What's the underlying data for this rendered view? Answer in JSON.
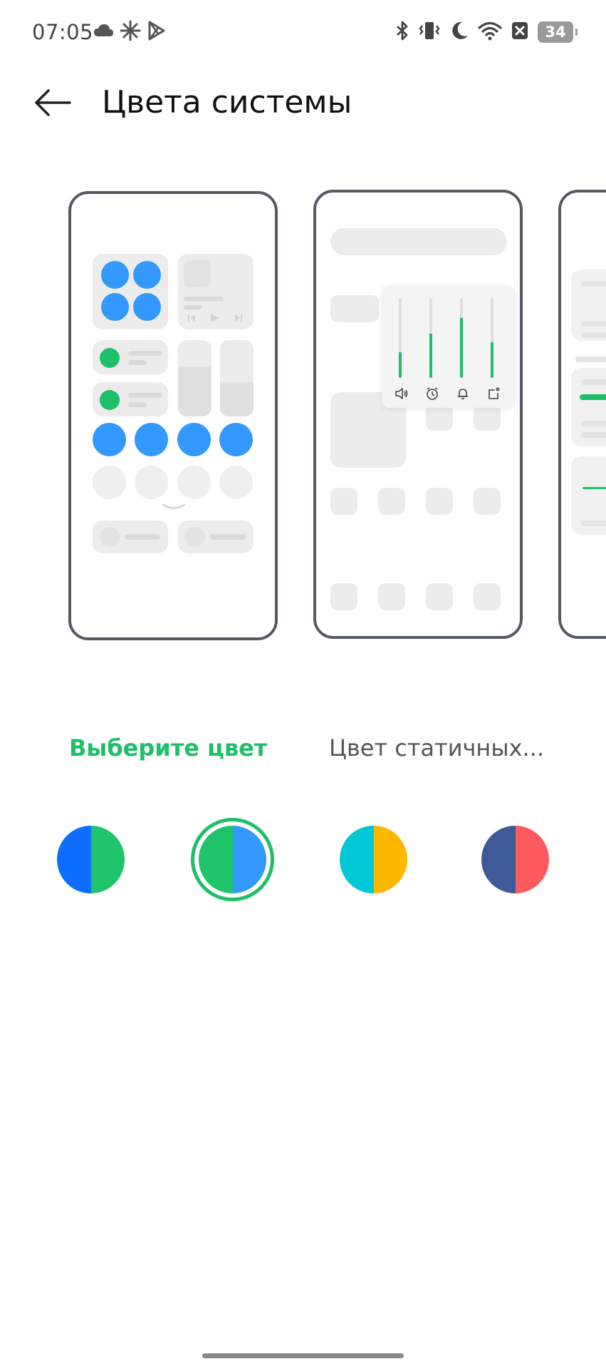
{
  "status_bar": {
    "time": "07:05",
    "left_icons": [
      "cloud-icon",
      "sun-icon",
      "play-store-icon"
    ],
    "right_icons": [
      "bluetooth-icon",
      "vibrate-icon",
      "moon-icon",
      "wifi-icon",
      "no-sim-icon"
    ],
    "battery": "34"
  },
  "header": {
    "back_icon": "arrow-left-icon",
    "title": "Цвета системы"
  },
  "previews": {
    "accent_color": "#3399ff",
    "secondary_color": "#1fbf68",
    "volume_levels": [
      0.32,
      0.55,
      0.75,
      0.45
    ],
    "volume_icons": [
      "speaker-icon",
      "alarm-icon",
      "bell-icon",
      "cast-icon"
    ]
  },
  "tabs": {
    "active": "Выберите цвет",
    "inactive": "Цвет статичных..."
  },
  "palette": {
    "selected_index": 1,
    "selection_color": "#1fbf68",
    "swatches": [
      {
        "left": "#0d6efd",
        "right": "#1fc36a"
      },
      {
        "left": "#1fc36a",
        "right": "#3399ff"
      },
      {
        "left": "#00c8d7",
        "right": "#ffb800"
      },
      {
        "left": "#3e5a99",
        "right": "#ff5a60"
      }
    ]
  }
}
